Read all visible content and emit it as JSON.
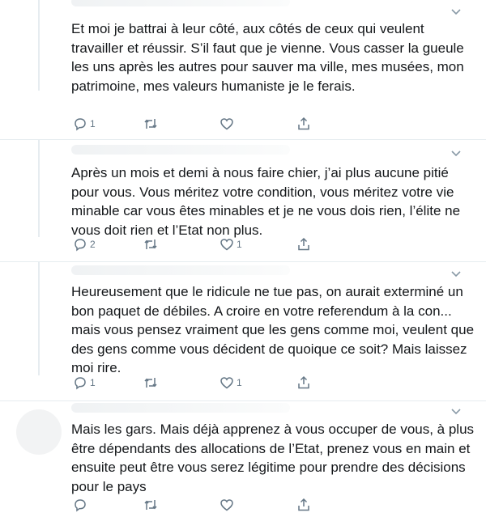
{
  "tweets": [
    {
      "text": "Et moi je battrai à leur côté, aux côtés de ceux qui veulent travailler et réussir. S’il faut que je vienne. Vous casser la gueule les uns après les autres pour sauver ma ville, mes musées, mon patrimoine, mes valeurs humaniste je le ferais.",
      "reply_count": "1",
      "retweet_count": "",
      "like_count": ""
    },
    {
      "text": "Après un mois et demi à nous faire chier, j’ai plus aucune pitié pour vous. Vous méritez votre condition, vous méritez votre vie minable car vous êtes minables et je ne vous dois rien, l’élite ne vous doit rien et l’Etat non plus.",
      "reply_count": "2",
      "retweet_count": "",
      "like_count": "1"
    },
    {
      "text": "Heureusement que le ridicule ne tue pas, on aurait exterminé un bon paquet de débiles. A croire en votre referendum à la con... mais vous pensez vraiment que les gens comme moi, veulent que des gens comme vous décident de quoique ce soit? Mais laissez moi rire.",
      "reply_count": "1",
      "retweet_count": "",
      "like_count": "1"
    },
    {
      "text": "Mais les gars. Mais déjà apprenez à vous occuper de vous, à plus être dépendants des allocations de l’Etat, prenez vous en main et ensuite peut être vous serez légitime pour prendre des décisions pour le pays",
      "reply_count": "",
      "retweet_count": "",
      "like_count": ""
    }
  ],
  "icons": {
    "reply": "reply-icon",
    "retweet": "retweet-icon",
    "like": "like-icon",
    "share": "share-icon",
    "more": "chevron-down-icon"
  },
  "colors": {
    "text": "#14171a",
    "icon": "#657786",
    "divider": "#e6ecf0"
  }
}
